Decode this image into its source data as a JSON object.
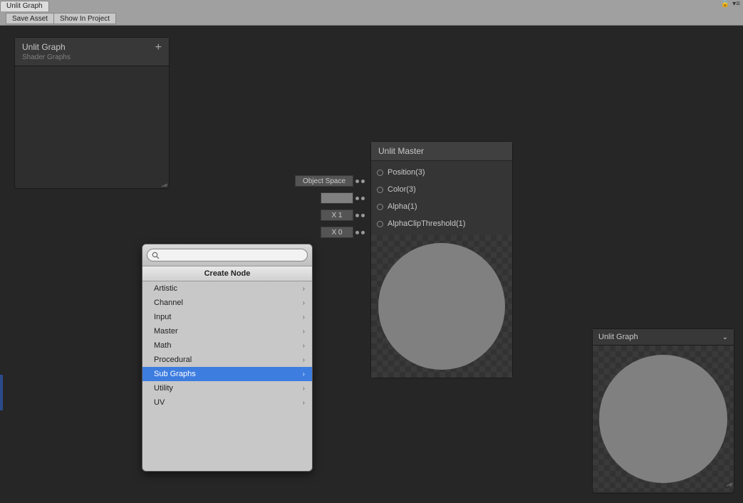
{
  "window": {
    "title": "Unlit Graph"
  },
  "toolbar": {
    "save": "Save Asset",
    "show": "Show In Project"
  },
  "blackboard": {
    "title": "Unlit Graph",
    "subtitle": "Shader Graphs",
    "add": "+"
  },
  "node": {
    "title": "Unlit Master",
    "ports": [
      {
        "label": "Position(3)",
        "input_type": "dropdown",
        "input_value": "Object Space"
      },
      {
        "label": "Color(3)",
        "input_type": "color",
        "input_value": "#808080"
      },
      {
        "label": "Alpha(1)",
        "input_type": "float",
        "input_value": "X 1"
      },
      {
        "label": "AlphaClipThreshold(1)",
        "input_type": "float",
        "input_value": "X 0"
      }
    ]
  },
  "searcher": {
    "placeholder": "",
    "title": "Create Node",
    "items": [
      {
        "label": "Artistic"
      },
      {
        "label": "Channel"
      },
      {
        "label": "Input"
      },
      {
        "label": "Master"
      },
      {
        "label": "Math"
      },
      {
        "label": "Procedural"
      },
      {
        "label": "Sub Graphs",
        "selected": true
      },
      {
        "label": "Utility"
      },
      {
        "label": "UV"
      }
    ]
  },
  "mainpreview": {
    "title": "Unlit Graph"
  }
}
